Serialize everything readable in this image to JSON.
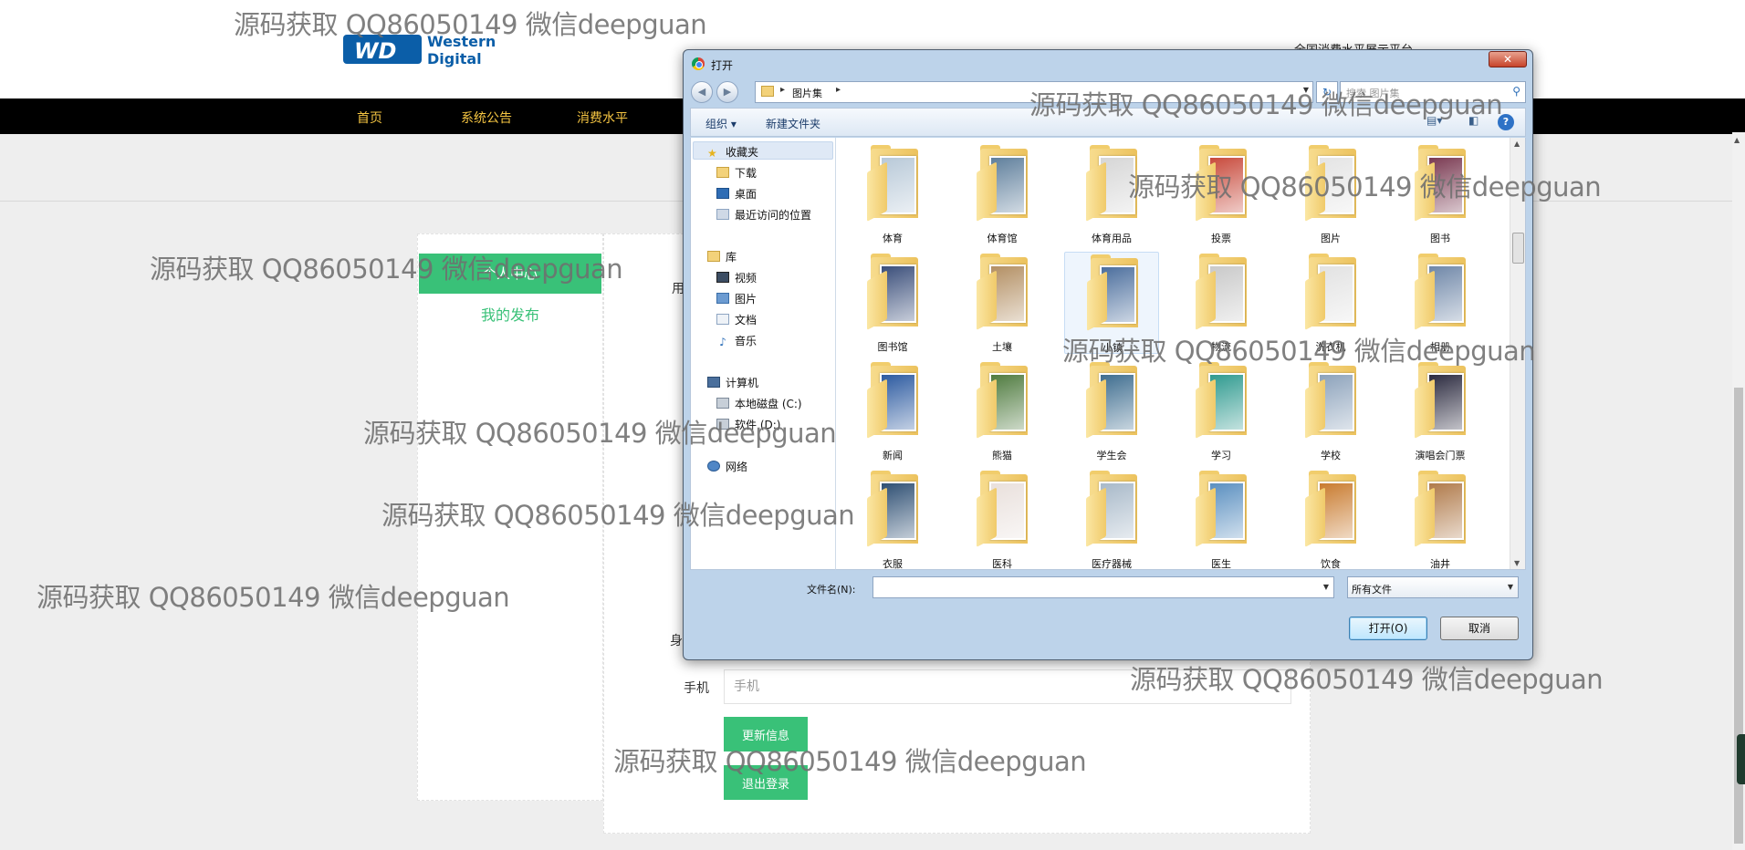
{
  "site": {
    "logo_line1": "Western",
    "logo_line2": "Digital",
    "logo_mark": "WD",
    "title": "全国消费水平展示平台",
    "brand_color": "#0b5ea8",
    "accent_green": "#39c178",
    "nav_color": "#f5c542"
  },
  "nav": {
    "items": [
      "首页",
      "系统公告",
      "消费水平"
    ]
  },
  "sidebar": {
    "active": "个人中心",
    "link": "我的发布"
  },
  "form": {
    "label_user": "用",
    "label_id": "身",
    "phone_label": "手机",
    "phone_placeholder": "手机",
    "update_button": "更新信息",
    "logout_button": "退出登录"
  },
  "dialog": {
    "title": "打开",
    "close": "✕",
    "back": "◀",
    "forward": "▶",
    "path": [
      "图片集"
    ],
    "refresh": "↻",
    "search_placeholder": "搜索 图片集",
    "search_icon": "search-icon",
    "toolbar": {
      "organize": "组织",
      "new_folder": "新建文件夹"
    },
    "nav_tree": {
      "favorites": "收藏夹",
      "downloads": "下载",
      "desktop": "桌面",
      "recent": "最近访问的位置",
      "libraries": "库",
      "videos": "视频",
      "pictures": "图片",
      "documents": "文档",
      "music": "音乐",
      "computer": "计算机",
      "disk_c": "本地磁盘 (C:)",
      "disk_d": "软件 (D:)",
      "network": "网络"
    },
    "folders": [
      {
        "name": "体育",
        "thumb": "#b8c9d8"
      },
      {
        "name": "体育馆",
        "thumb": "#5f7f9c"
      },
      {
        "name": "体育用品",
        "thumb": "#d6d6d6"
      },
      {
        "name": "投票",
        "thumb": "#c84a3c"
      },
      {
        "name": "图片",
        "thumb": "#e4e4e4"
      },
      {
        "name": "图书",
        "thumb": "#7a3a52"
      },
      {
        "name": "图书馆",
        "thumb": "#3a4e7a"
      },
      {
        "name": "土壤",
        "thumb": "#b38f63"
      },
      {
        "name": "小镇",
        "thumb": "#4b6e9d"
      },
      {
        "name": "物流",
        "thumb": "#c9c9c9"
      },
      {
        "name": "洗衣机",
        "thumb": "#e2e2e2"
      },
      {
        "name": "相册",
        "thumb": "#6f87a8"
      },
      {
        "name": "新闻",
        "thumb": "#2c5aa0"
      },
      {
        "name": "熊猫",
        "thumb": "#4f7b3f"
      },
      {
        "name": "学生会",
        "thumb": "#3e6d8f"
      },
      {
        "name": "学习",
        "thumb": "#2f9a8f"
      },
      {
        "name": "学校",
        "thumb": "#8ca2bb"
      },
      {
        "name": "演唱会门票",
        "thumb": "#2b2a3f"
      },
      {
        "name": "衣服",
        "thumb": "#2e4f73"
      },
      {
        "name": "医科",
        "thumb": "#e9e0dc"
      },
      {
        "name": "医疗器械",
        "thumb": "#a8b9c9"
      },
      {
        "name": "医生",
        "thumb": "#5a8fc0"
      },
      {
        "name": "饮食",
        "thumb": "#c97b2f"
      },
      {
        "name": "油井",
        "thumb": "#b07a4a"
      }
    ],
    "filename_label": "文件名(N):",
    "filename_value": "",
    "filetype": "所有文件",
    "open_button": "打开(O)",
    "cancel_button": "取消"
  },
  "watermark": "源码获取 QQ86050149 微信deepguan"
}
